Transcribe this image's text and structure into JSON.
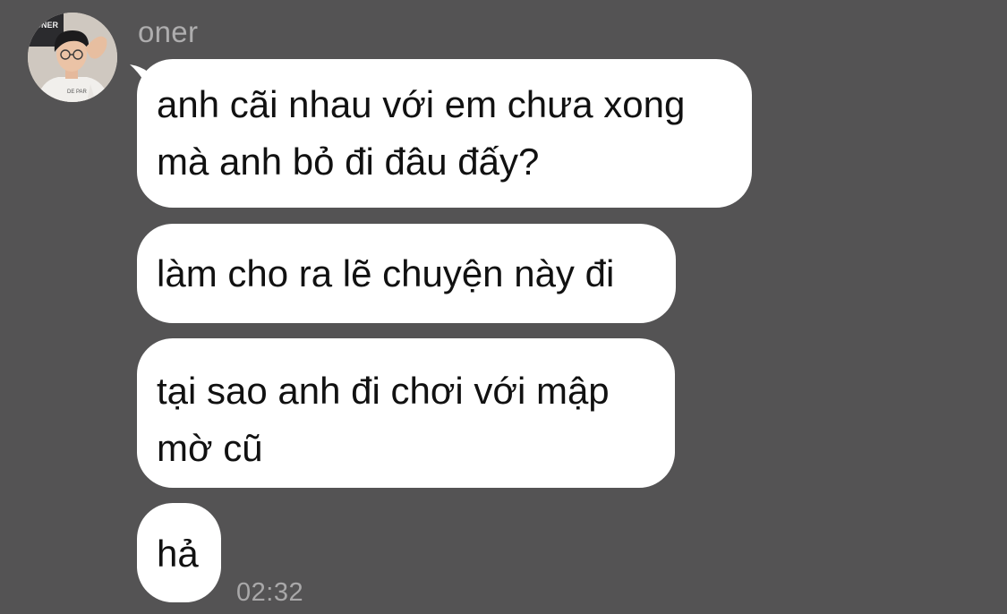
{
  "sender": {
    "name": "oner",
    "avatar_shirt_text": "ONER"
  },
  "messages": [
    {
      "lines": [
        "anh cãi nhau với em chưa xong",
        "mà anh bỏ đi đâu đấy?"
      ]
    },
    {
      "lines": [
        "làm cho ra lẽ chuyện này đi"
      ]
    },
    {
      "lines": [
        "tại sao anh đi chơi với mập",
        "mờ cũ"
      ]
    },
    {
      "lines": [
        "hả"
      ]
    }
  ],
  "last_message_time": "02:32",
  "colors": {
    "background": "#545354",
    "bubble": "#ffffff",
    "text": "#111111",
    "meta_text": "#aeadae"
  }
}
